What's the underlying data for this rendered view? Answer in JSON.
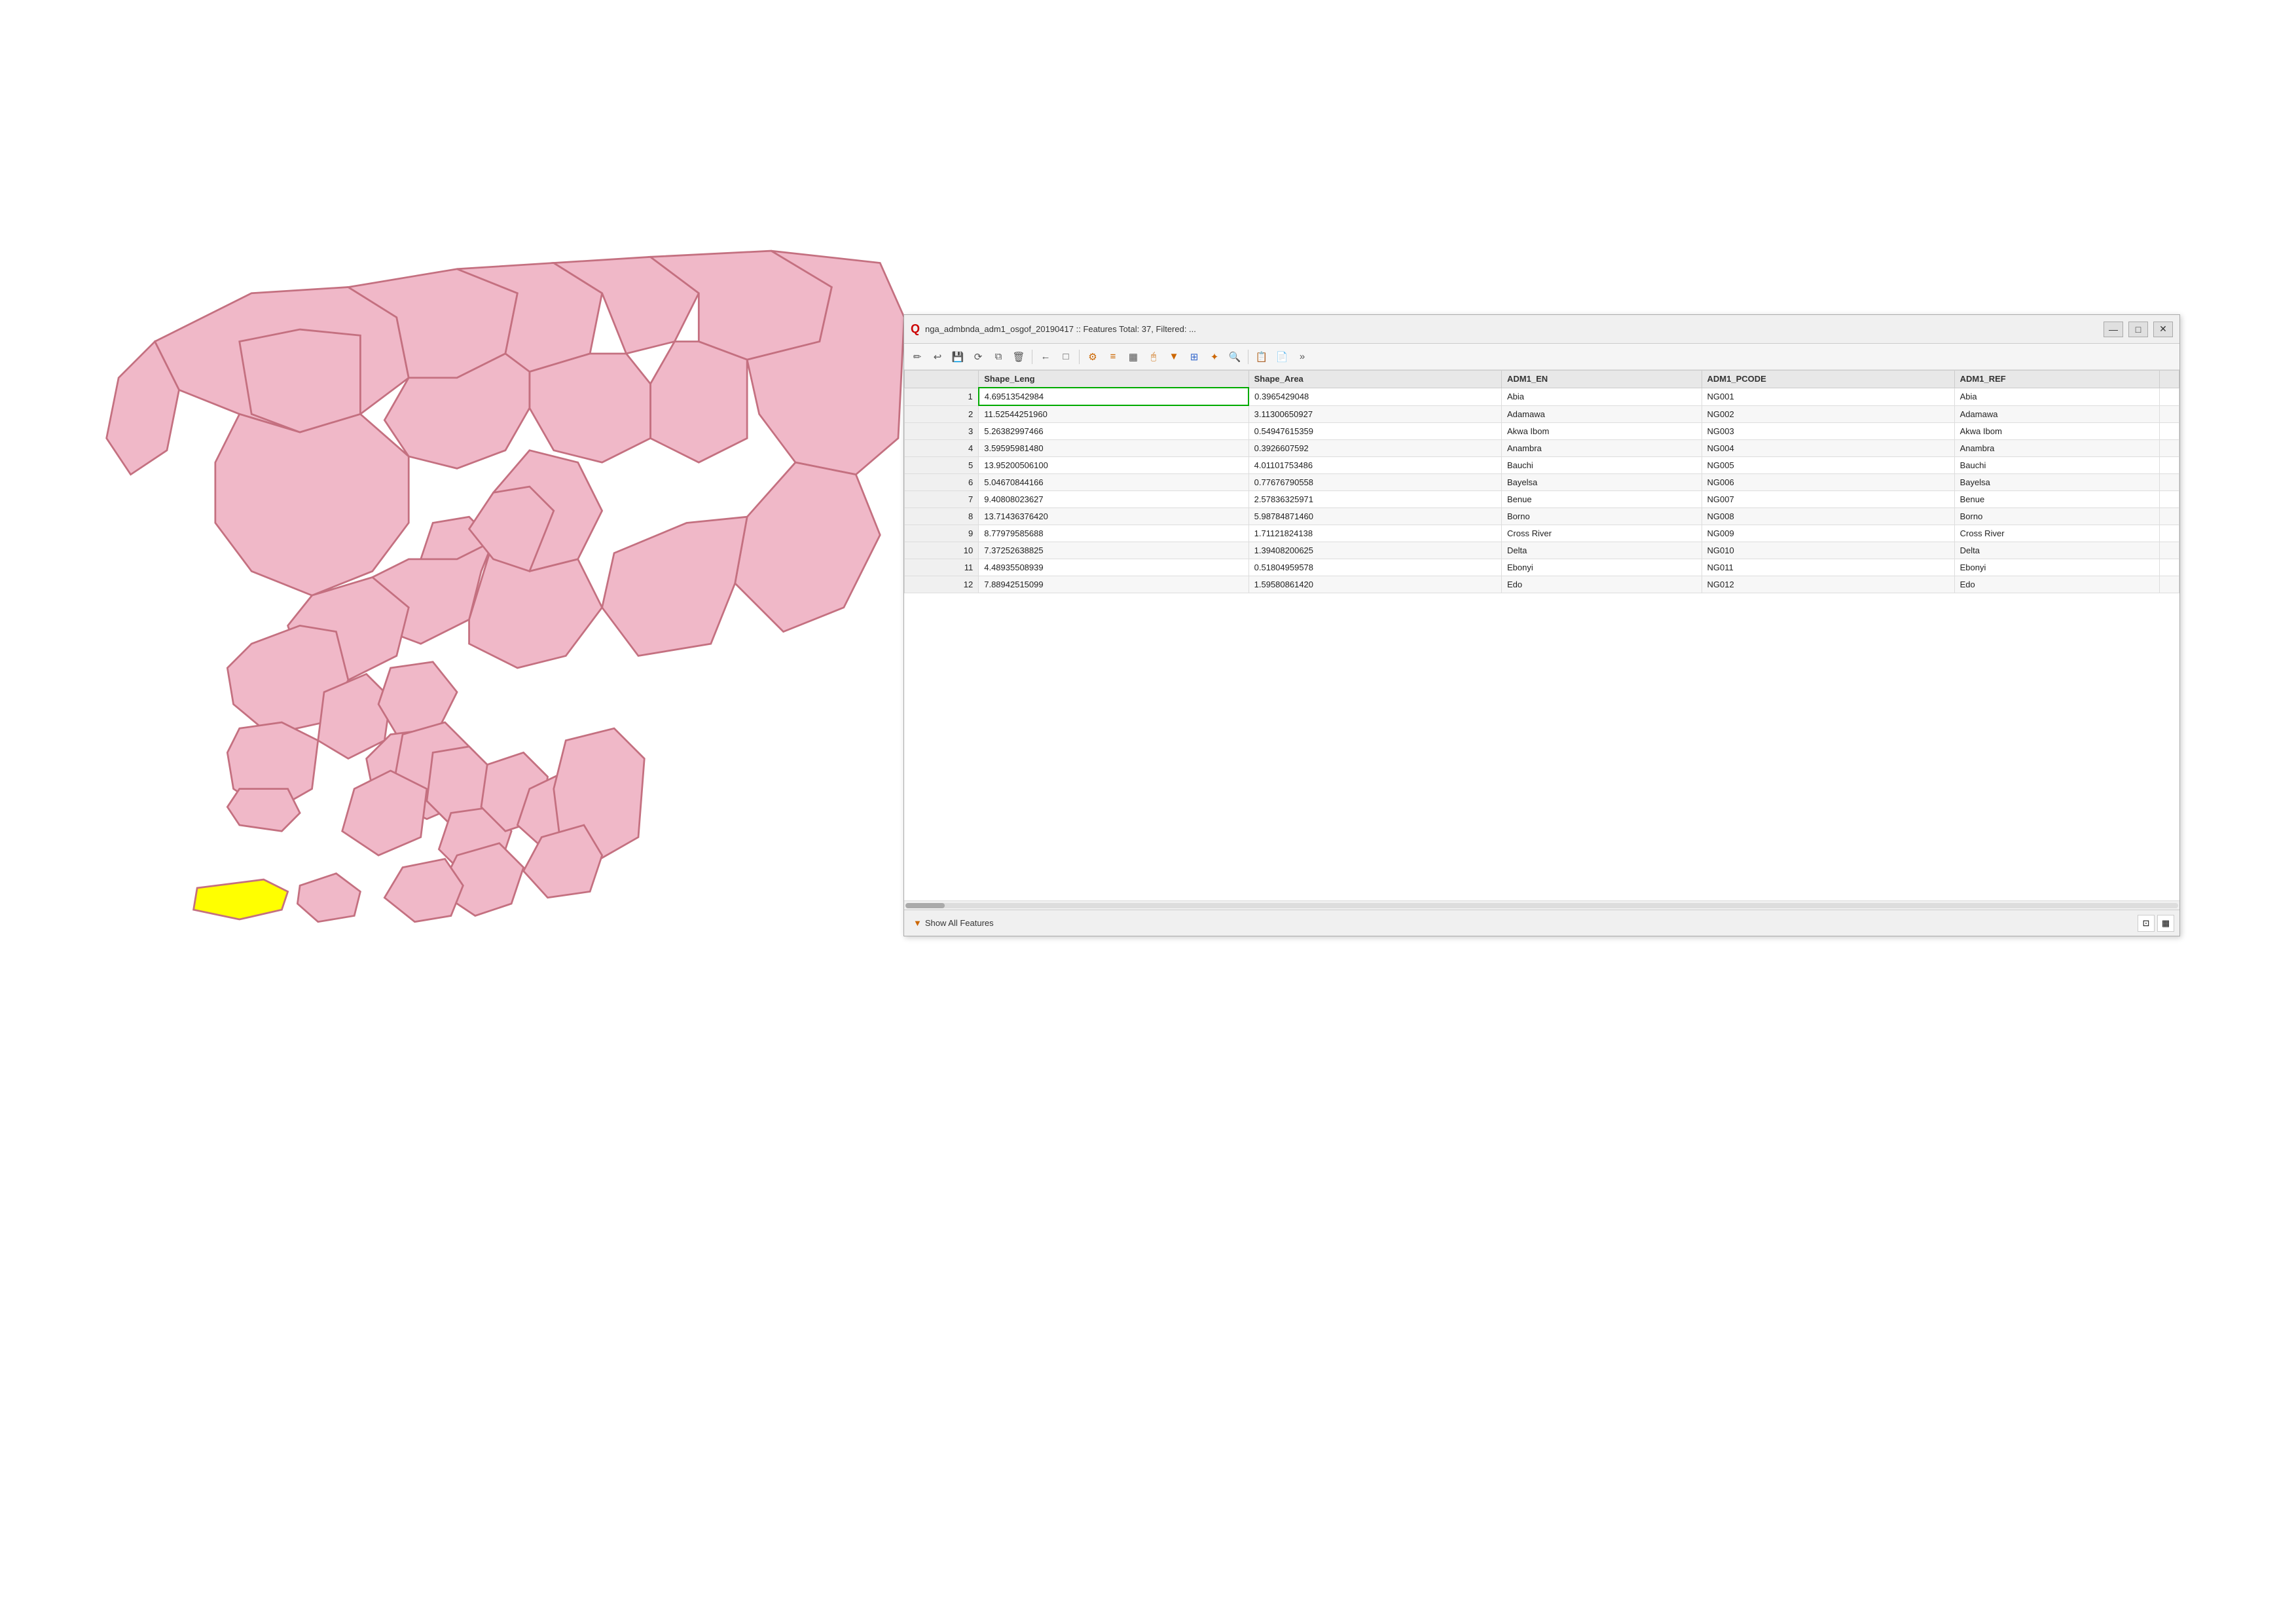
{
  "window": {
    "title": "nga_admbnda_adm1_osgof_20190417 :: Features Total: 37, Filtered: ...",
    "title_icon": "Q",
    "min_btn": "—",
    "max_btn": "□",
    "close_btn": "✕"
  },
  "toolbar": {
    "buttons": [
      {
        "name": "edit-icon",
        "symbol": "✏",
        "label": "Edit"
      },
      {
        "name": "undo-icon",
        "symbol": "↩",
        "label": "Undo"
      },
      {
        "name": "save-icon",
        "symbol": "💾",
        "label": "Save"
      },
      {
        "name": "refresh-icon",
        "symbol": "⟳",
        "label": "Refresh"
      },
      {
        "name": "copy-icon",
        "symbol": "⧉",
        "label": "Copy"
      },
      {
        "name": "delete-icon",
        "symbol": "🗑",
        "label": "Delete"
      },
      {
        "name": "sep1",
        "type": "separator"
      },
      {
        "name": "back-icon",
        "symbol": "←",
        "label": "Back"
      },
      {
        "name": "fwd-icon",
        "symbol": "□",
        "label": "Forward"
      },
      {
        "name": "sep2",
        "type": "separator"
      },
      {
        "name": "field1-icon",
        "symbol": "⚙",
        "label": "Field1"
      },
      {
        "name": "table-icon",
        "symbol": "≡",
        "label": "Table"
      },
      {
        "name": "sort-icon",
        "symbol": "▦",
        "label": "Sort"
      },
      {
        "name": "sel-icon",
        "symbol": "🖰",
        "label": "Select"
      },
      {
        "name": "filter-icon",
        "symbol": "▼",
        "label": "Filter"
      },
      {
        "name": "grid-icon",
        "symbol": "⊞",
        "label": "Grid"
      },
      {
        "name": "star-icon",
        "symbol": "✦",
        "label": "Star"
      },
      {
        "name": "search-icon",
        "symbol": "🔍",
        "label": "Search"
      },
      {
        "name": "sep3",
        "type": "separator"
      },
      {
        "name": "copy2-icon",
        "symbol": "📋",
        "label": "Copy2"
      },
      {
        "name": "paste-icon",
        "symbol": "📄",
        "label": "Paste"
      },
      {
        "name": "more-icon",
        "symbol": "»",
        "label": "More"
      }
    ]
  },
  "table": {
    "columns": [
      "",
      "Shape_Leng",
      "Shape_Area",
      "ADM1_EN",
      "ADM1_PCODE",
      "ADM1_REF"
    ],
    "rows": [
      {
        "id": 1,
        "shape_leng": "4.69513542984",
        "shape_area": "0.3965429048",
        "adm1_en": "Abia",
        "adm1_pcode": "NG001",
        "adm1_ref": "Abia",
        "highlight": true
      },
      {
        "id": 2,
        "shape_leng": "11.52544251960",
        "shape_area": "3.11300650927",
        "adm1_en": "Adamawa",
        "adm1_pcode": "NG002",
        "adm1_ref": "Adamawa"
      },
      {
        "id": 3,
        "shape_leng": "5.26382997466",
        "shape_area": "0.54947615359",
        "adm1_en": "Akwa Ibom",
        "adm1_pcode": "NG003",
        "adm1_ref": "Akwa Ibom"
      },
      {
        "id": 4,
        "shape_leng": "3.59595981480",
        "shape_area": "0.3926607592",
        "adm1_en": "Anambra",
        "adm1_pcode": "NG004",
        "adm1_ref": "Anambra"
      },
      {
        "id": 5,
        "shape_leng": "13.95200506100",
        "shape_area": "4.01101753486",
        "adm1_en": "Bauchi",
        "adm1_pcode": "NG005",
        "adm1_ref": "Bauchi"
      },
      {
        "id": 6,
        "shape_leng": "5.04670844166",
        "shape_area": "0.77676790558",
        "adm1_en": "Bayelsa",
        "adm1_pcode": "NG006",
        "adm1_ref": "Bayelsa"
      },
      {
        "id": 7,
        "shape_leng": "9.40808023627",
        "shape_area": "2.57836325971",
        "adm1_en": "Benue",
        "adm1_pcode": "NG007",
        "adm1_ref": "Benue"
      },
      {
        "id": 8,
        "shape_leng": "13.71436376420",
        "shape_area": "5.98784871460",
        "adm1_en": "Borno",
        "adm1_pcode": "NG008",
        "adm1_ref": "Borno"
      },
      {
        "id": 9,
        "shape_leng": "8.77979585688",
        "shape_area": "1.71121824138",
        "adm1_en": "Cross River",
        "adm1_pcode": "NG009",
        "adm1_ref": "Cross River"
      },
      {
        "id": 10,
        "shape_leng": "7.37252638825",
        "shape_area": "1.39408200625",
        "adm1_en": "Delta",
        "adm1_pcode": "NG010",
        "adm1_ref": "Delta"
      },
      {
        "id": 11,
        "shape_leng": "4.48935508939",
        "shape_area": "0.51804959578",
        "adm1_en": "Ebonyi",
        "adm1_pcode": "NG011",
        "adm1_ref": "Ebonyi"
      },
      {
        "id": 12,
        "shape_leng": "7.88942515099",
        "shape_area": "1.59580861420",
        "adm1_en": "Edo",
        "adm1_pcode": "NG012",
        "adm1_ref": "Edo"
      }
    ]
  },
  "bottom_bar": {
    "show_all_label": "Show All Features",
    "filter_icon": "▼"
  },
  "colors": {
    "map_fill": "#f0b8c8",
    "map_stroke": "#c47080",
    "map_highlight": "#ffff00",
    "highlight_border": "#00aa00",
    "window_bg": "#ffffff"
  }
}
